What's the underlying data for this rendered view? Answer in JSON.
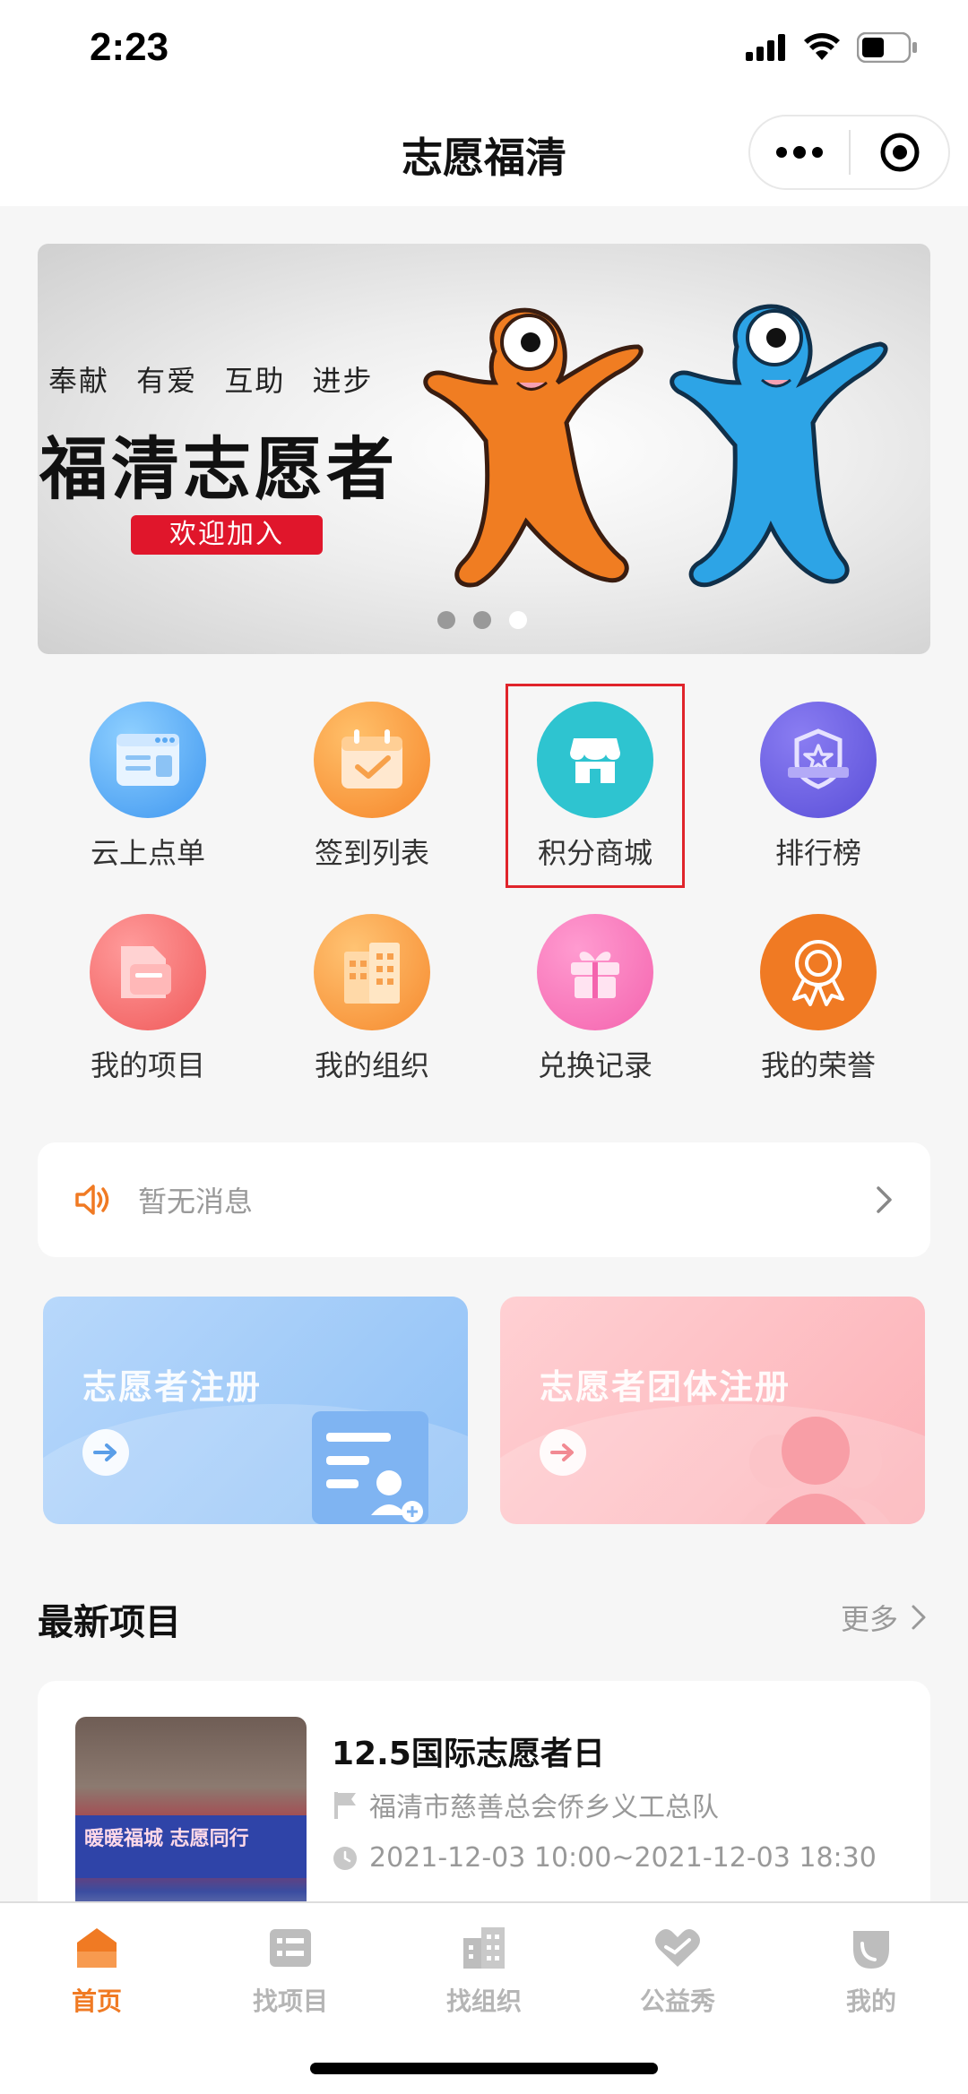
{
  "status_bar": {
    "time": "2:23"
  },
  "nav": {
    "title": "志愿福清",
    "more_icon": "ellipsis-icon",
    "close_icon": "target-icon"
  },
  "banner": {
    "slogan": "奉献 有爱 互助 进步",
    "headline": "福清志愿者",
    "button": "欢迎加入",
    "dots": 3,
    "active_dot": 3
  },
  "menu": [
    {
      "label": "云上点单",
      "icon": "order-icon",
      "color": "#4aa3f5"
    },
    {
      "label": "签到列表",
      "icon": "calendar-check-icon",
      "color": "#f8952c"
    },
    {
      "label": "积分商城",
      "icon": "store-icon",
      "color": "#2ec4d0"
    },
    {
      "label": "排行榜",
      "icon": "ranking-badge-icon",
      "color": "#6a5ce6"
    },
    {
      "label": "我的项目",
      "icon": "project-folder-icon",
      "color": "#f56c6c"
    },
    {
      "label": "我的组织",
      "icon": "building-icon",
      "color": "#f7962e"
    },
    {
      "label": "兑换记录",
      "icon": "gift-icon",
      "color": "#f472b6"
    },
    {
      "label": "我的荣誉",
      "icon": "medal-icon",
      "color": "#f07a23"
    }
  ],
  "notice": {
    "text": "暂无消息",
    "icon": "speaker-icon"
  },
  "cards": [
    {
      "title": "志愿者注册",
      "icon": "register-form-icon"
    },
    {
      "title": "志愿者团体注册",
      "icon": "group-icon"
    }
  ],
  "section": {
    "title": "最新项目",
    "more": "更多"
  },
  "project": {
    "name": "12.5国际志愿者日",
    "org": "福清市慈善总会侨乡义工总队",
    "time": "2021-12-03 10:00~2021-12-03 18:30",
    "thumb_text": "暖暖福城 志愿同行"
  },
  "tabs": [
    {
      "label": "首页",
      "icon": "home-icon",
      "active": true
    },
    {
      "label": "找项目",
      "icon": "list-icon",
      "active": false
    },
    {
      "label": "找组织",
      "icon": "building-icon",
      "active": false
    },
    {
      "label": "公益秀",
      "icon": "heart-hands-icon",
      "active": false
    },
    {
      "label": "我的",
      "icon": "profile-icon",
      "active": false
    }
  ],
  "colors": {
    "accent": "#f07a23",
    "highlight": "#e0242b",
    "banner_button": "#e0162b"
  }
}
